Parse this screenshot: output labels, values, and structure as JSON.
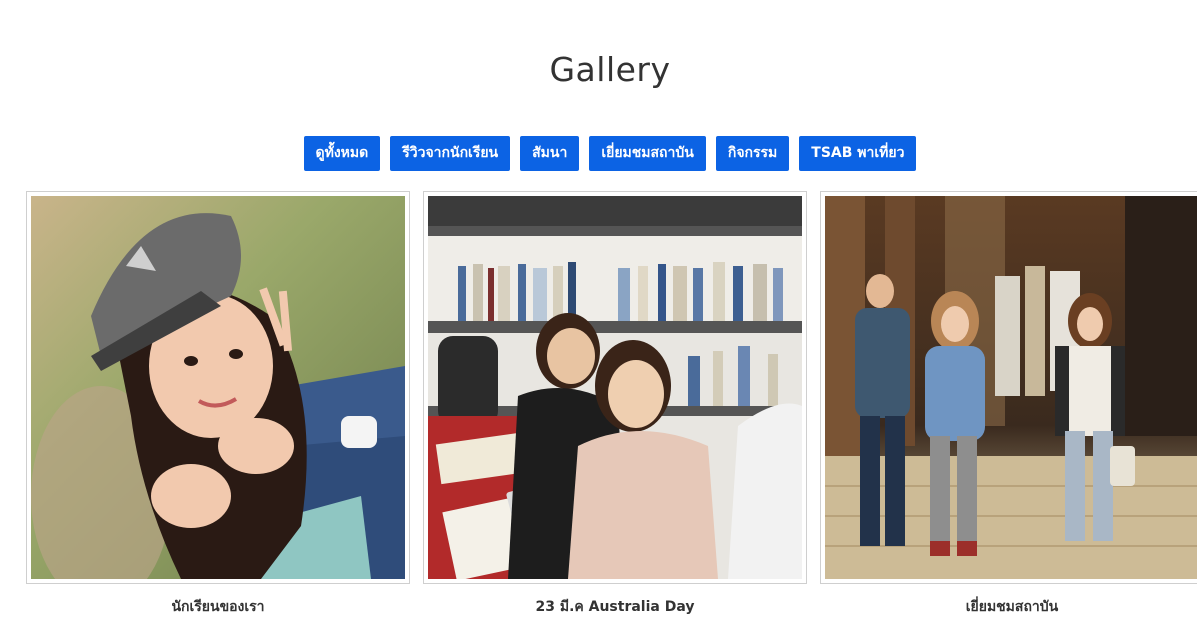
{
  "page": {
    "title": "Gallery"
  },
  "filters": [
    {
      "label": "ดูทั้งหมด"
    },
    {
      "label": "รีวิวจากนักเรียน"
    },
    {
      "label": "สัมนา"
    },
    {
      "label": "เยี่ยมชมสถาบัน"
    },
    {
      "label": "กิจกรรม"
    },
    {
      "label": "TSAB พาเที่ยว"
    }
  ],
  "gallery": {
    "items": [
      {
        "caption": "นักเรียนของเรา"
      },
      {
        "caption": "23 มี.ค Australia Day"
      },
      {
        "caption": "เยี่ยมชมสถาบัน"
      }
    ]
  },
  "colors": {
    "accent": "#0c63e4",
    "text": "#333333",
    "border": "#cfcfcf"
  }
}
